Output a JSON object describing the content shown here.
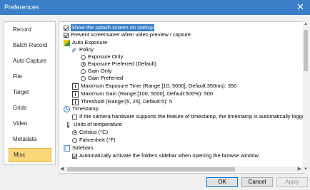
{
  "window": {
    "title": "Preferences",
    "close_symbol": "✕"
  },
  "sidebar": {
    "items": [
      {
        "label": "Record"
      },
      {
        "label": "Batch Record"
      },
      {
        "label": "Auto Capture"
      },
      {
        "label": "File"
      },
      {
        "label": "Target"
      },
      {
        "label": "Grids"
      },
      {
        "label": "Video"
      },
      {
        "label": "Metadata"
      },
      {
        "label": "Misc"
      }
    ],
    "selected": "Misc"
  },
  "content": {
    "show_splash": {
      "label": "Show the splash screen on startup",
      "checked": true
    },
    "prevent_screensaver": {
      "label": "Prevent screensaver when video preview / capture",
      "checked": true
    },
    "auto_exposure": {
      "label": "Auto Exposure",
      "policy_label": "Policy",
      "options": [
        {
          "label": "Exposure Only",
          "checked": false
        },
        {
          "label": "Exposure Preferred (Default)",
          "checked": true
        },
        {
          "label": "Gain Only",
          "checked": false
        },
        {
          "label": "Gain Preferred",
          "checked": false
        }
      ],
      "max_exposure": "Maximum Exposure Time (Range:[10, 5000], Default:350ms): 350",
      "max_gain": "Maximum Gain (Range:[100, 5000], Default:500%): 500",
      "threshold": "Threshold (Range:[5, 25], Default:5): 5"
    },
    "timestamp": {
      "label": "Timestamp",
      "option": {
        "label": "If the camera hardware supports the feature of timestamp, the timestamp is automatically logged",
        "checked": false
      }
    },
    "units_temperature": {
      "label": "Units of temperature",
      "options": [
        {
          "label": "Celsius (°C)",
          "checked": true
        },
        {
          "label": "Fahrenheit (°F)",
          "checked": false
        }
      ]
    },
    "sidebars": {
      "label": "Sidebars",
      "option": {
        "label": "Automatically activate the folders sidebar when opening the browse window",
        "checked": true
      }
    }
  },
  "buttons": {
    "ok": "OK",
    "cancel": "Cancel",
    "apply": "Apply"
  },
  "colors": {
    "titlebar": "#3a7fc8",
    "selected_item": "#fbd97b",
    "highlight": "#3a7fc8"
  }
}
